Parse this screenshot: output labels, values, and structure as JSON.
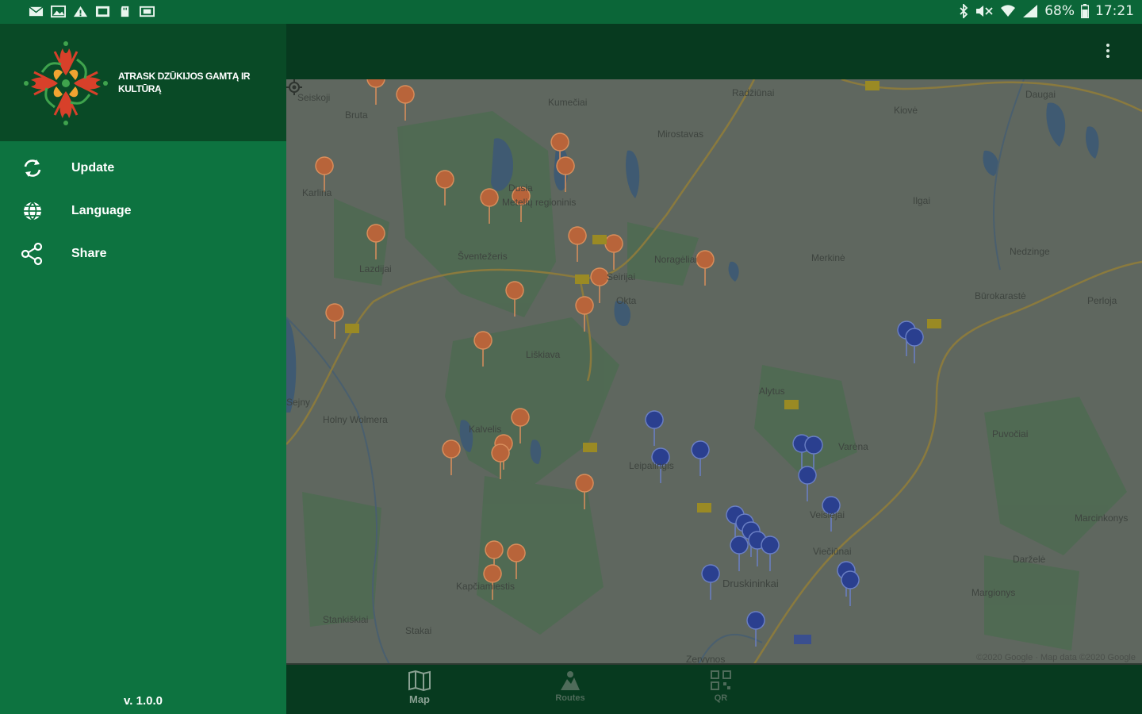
{
  "status_bar": {
    "battery": "68%",
    "time": "17:21"
  },
  "drawer": {
    "brand": "Atrask Dzūkijos gamtą ir kultūrą",
    "items": [
      {
        "label": "Update",
        "icon": "refresh-icon"
      },
      {
        "label": "Language",
        "icon": "globe-icon"
      },
      {
        "label": "Share",
        "icon": "share-icon"
      }
    ],
    "version": "v. 1.0.0"
  },
  "map": {
    "places": [
      "Seiskoji",
      "Bruta",
      "Kumečiai",
      "Radžiūnai",
      "Kiovė",
      "Daugai",
      "Mirostavas",
      "Rudnia",
      "Dusia",
      "Metelių regioninis",
      "Bardauskai",
      "Šventežeris",
      "Noragėliai",
      "Merkinė",
      "Nedzinge",
      "Lazdijai",
      "Seirijai",
      "Būrokarastė",
      "Okta",
      "Perloja",
      "Liškiava",
      "Alytus",
      "Leipalingis",
      "Varėna",
      "Veisiejai",
      "Druskininkai",
      "Viečiūnai",
      "Ratnyčia",
      "Marcinkonys",
      "Kapčiamiestis",
      "Puvočiai",
      "Darželė",
      "Margionys",
      "Stankiškiai",
      "Stakai",
      "Zervynos",
      "Kalvelis",
      "Holny Wolmera",
      "Sejny",
      "Karlina",
      "Ilgai",
      "Ilga"
    ],
    "road_labels": [
      "128",
      "181",
      "131",
      "135",
      "133",
      "129",
      "180"
    ],
    "copyright": "©2020 Google · Map data ©2020 Google"
  },
  "bottom_nav": [
    {
      "label": "Map",
      "icon": "map-icon",
      "active": true
    },
    {
      "label": "Routes",
      "icon": "route-icon",
      "active": false
    },
    {
      "label": "QR",
      "icon": "qr-icon",
      "active": false
    }
  ],
  "colors": {
    "primary": "#0d7340",
    "primary_dark": "#094a26",
    "app_bar": "#073a1f",
    "marker_orange": "#c8693a",
    "marker_blue": "#2a3f8f"
  }
}
